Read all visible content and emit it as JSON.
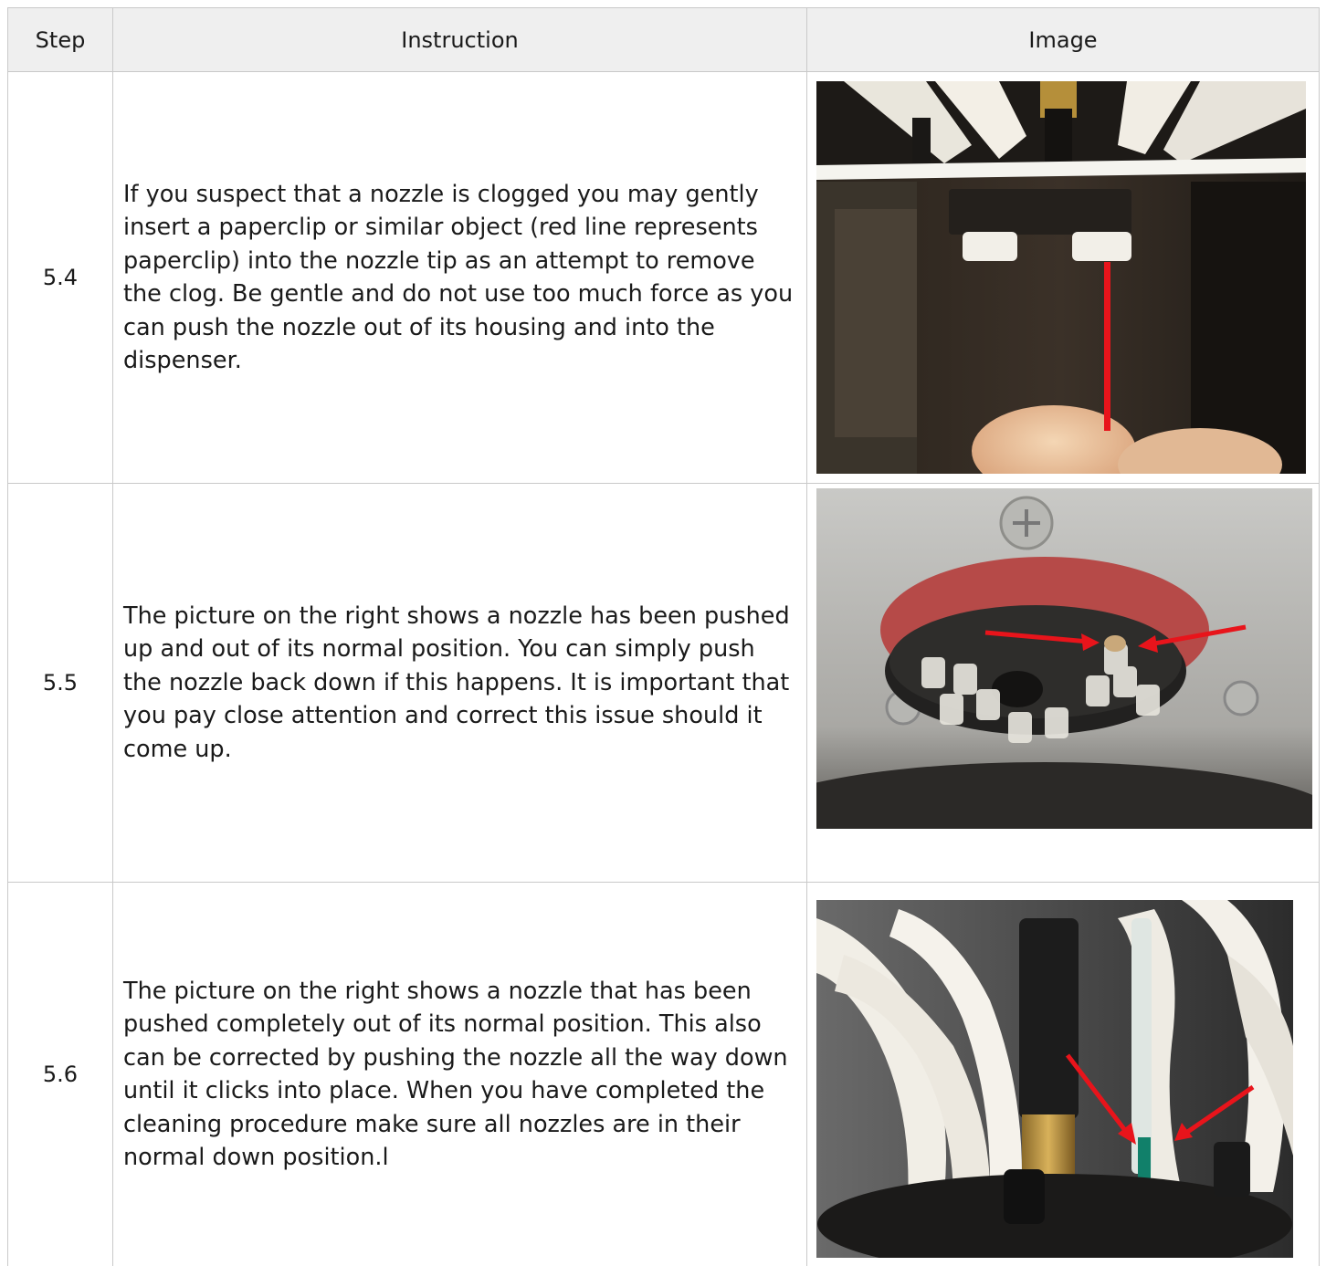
{
  "header": {
    "step": "Step",
    "instruction": "Instruction",
    "image": "Image"
  },
  "rows": [
    {
      "step": "5.4",
      "instruction": "If you suspect that a nozzle is clogged you may gently insert a paperclip or similar object (red line represents paperclip) into the nozzle tip as an attempt to remove the clog. Be gentle and do not use too much force as you can push the nozzle out of its housing and into the dispenser."
    },
    {
      "step": "5.5",
      "instruction": "The picture on the right shows a nozzle has been pushed up and out of its normal position. You can simply push the nozzle back down if this happens. It is important that you pay close attention and correct this issue should it come up."
    },
    {
      "step": "5.6",
      "instruction": "The picture on the right shows a nozzle that has been pushed completely out of its normal position. This also can be corrected by pushing the nozzle all the way down until it clicks into place. When you have completed the cleaning procedure make sure all nozzles are in their normal down position.l"
    }
  ],
  "colors": {
    "header_bg": "#efefef",
    "border": "#c9c9c9",
    "annotation_red": "#e8141b"
  }
}
